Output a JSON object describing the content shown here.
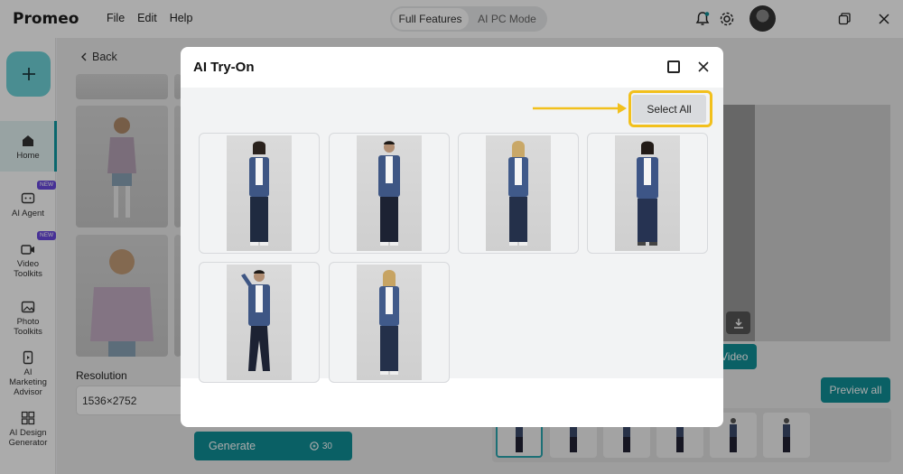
{
  "app": {
    "name": "Promeo",
    "menu": [
      "File",
      "Edit",
      "Help"
    ],
    "modes": [
      "Full Features",
      "AI PC Mode"
    ]
  },
  "sidebar": {
    "items": [
      {
        "label": "Home",
        "icon": "home-icon",
        "badge": ""
      },
      {
        "label": "AI Agent",
        "icon": "ai-agent-icon",
        "badge": "NEW"
      },
      {
        "label": "Video Toolkits",
        "icon": "video-icon",
        "badge": "NEW"
      },
      {
        "label": "Photo Toolkits",
        "icon": "photo-icon",
        "badge": ""
      },
      {
        "label": "AI Marketing Advisor",
        "icon": "marketing-icon",
        "badge": ""
      },
      {
        "label": "AI Design Generator",
        "icon": "design-grid-icon",
        "badge": ""
      }
    ]
  },
  "main": {
    "back_label": "Back",
    "resolution_label": "Resolution",
    "resolution_value": "1536×2752",
    "generate_label": "Generate",
    "generate_cost": "30",
    "video_label": "Video",
    "preview_all_label": "Preview all"
  },
  "dialog": {
    "title": "AI Try-On",
    "select_all_label": "Select All",
    "images": [
      {
        "name": "woman-dark-hair"
      },
      {
        "name": "man-short-hair"
      },
      {
        "name": "woman-blonde"
      },
      {
        "name": "woman-dark-hair-2"
      },
      {
        "name": "man-posing"
      },
      {
        "name": "woman-blonde-2"
      }
    ]
  },
  "colors": {
    "accent": "#0f8f97",
    "highlight": "#f2c01c",
    "badge": "#6b4ae0"
  }
}
